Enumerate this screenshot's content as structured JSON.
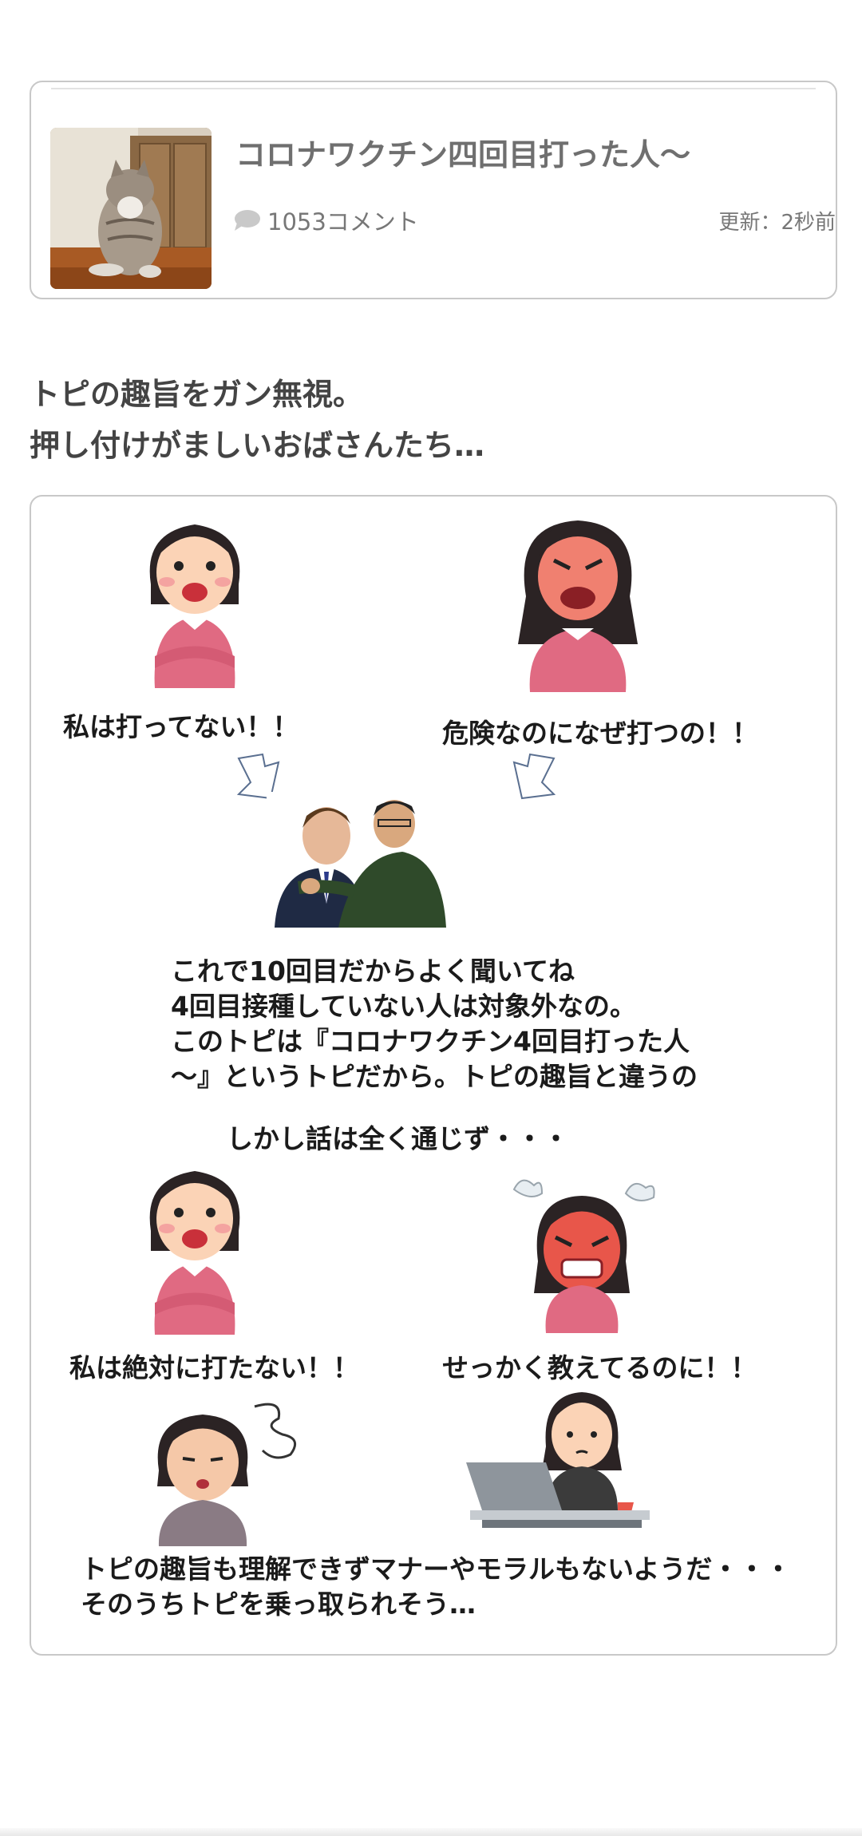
{
  "topic": {
    "title": "コロナワクチン四回目打った人〜",
    "comment_count": "1053コメント",
    "updated": "更新：2秒前",
    "thumbnail_icon": "cat-photo"
  },
  "heading": {
    "line1": "トピの趣旨をガン無視。",
    "line2": "押し付けがましいおばさんたち…"
  },
  "panel": {
    "speech1": "私は打ってない！！",
    "speech2": "危険なのになぜ打つの！！",
    "explain_line1": "これで10回目だからよく聞いてね",
    "explain_line2": "4回目接種していない人は対象外なの。",
    "explain_line3": "このトピは『コロナワクチン4回目打った人",
    "explain_line4": "〜』というトピだから。トピの趣旨と違うの",
    "narration1": "しかし話は全く通じず・・・",
    "speech3": "私は絶対に打たない！！",
    "speech4": "せっかく教えてるのに！！",
    "closing_line1": "トピの趣旨も理解できずマナーやモラルもないようだ・・・",
    "closing_line2": "そのうちトピを乗っ取られそう…"
  },
  "colors": {
    "card_border": "#c8c8c8",
    "title_gray": "#6f6f6f",
    "pink_sweater": "#e06a82",
    "angry_face": "#f08070"
  }
}
